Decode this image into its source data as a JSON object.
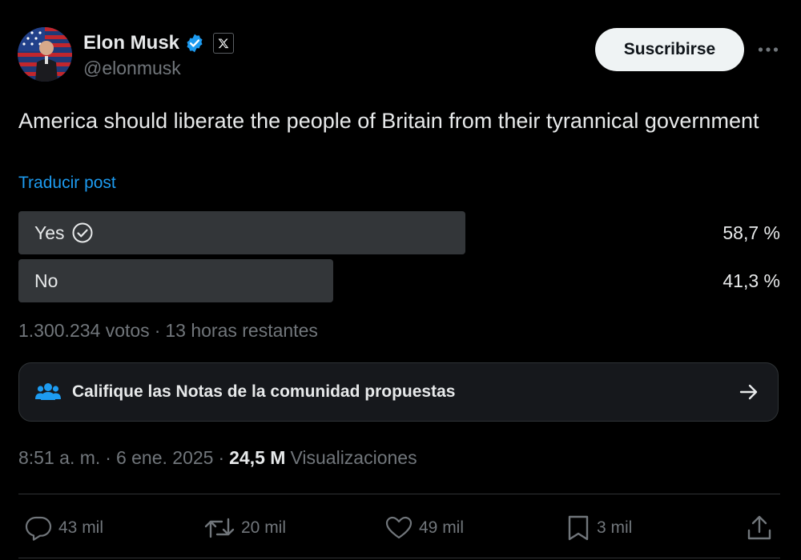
{
  "author": {
    "display_name": "Elon Musk",
    "handle": "@elonmusk",
    "verified_icon": "verified-badge-icon",
    "affiliation_icon": "x-logo-icon"
  },
  "header": {
    "subscribe_label": "Suscribirse",
    "more_icon": "more-icon"
  },
  "post": {
    "text": "America should liberate the people of Britain from their tyrannical government",
    "translate_label": "Traducir post"
  },
  "poll": {
    "options": [
      {
        "label": "Yes",
        "percent_text": "58,7 %",
        "share": 0.587,
        "selected": true
      },
      {
        "label": "No",
        "percent_text": "41,3 %",
        "share": 0.413,
        "selected": false
      }
    ],
    "votes": "1.300.234 votos",
    "separator": "·",
    "time_left": "13 horas restantes"
  },
  "community_notes": {
    "label": "Califique las Notas de la comunidad propuestas"
  },
  "meta": {
    "time": "8:51 a. m.",
    "separator": "·",
    "date": "6 ene. 2025",
    "views_count": "24,5 M",
    "views_label": "Visualizaciones"
  },
  "actions": {
    "replies": "43 mil",
    "reposts": "20 mil",
    "likes": "49 mil",
    "bookmarks": "3 mil"
  },
  "colors": {
    "accent": "#1d9bf0",
    "poll_bar": "#333639",
    "muted": "#71767b",
    "text": "#e7e9ea"
  }
}
